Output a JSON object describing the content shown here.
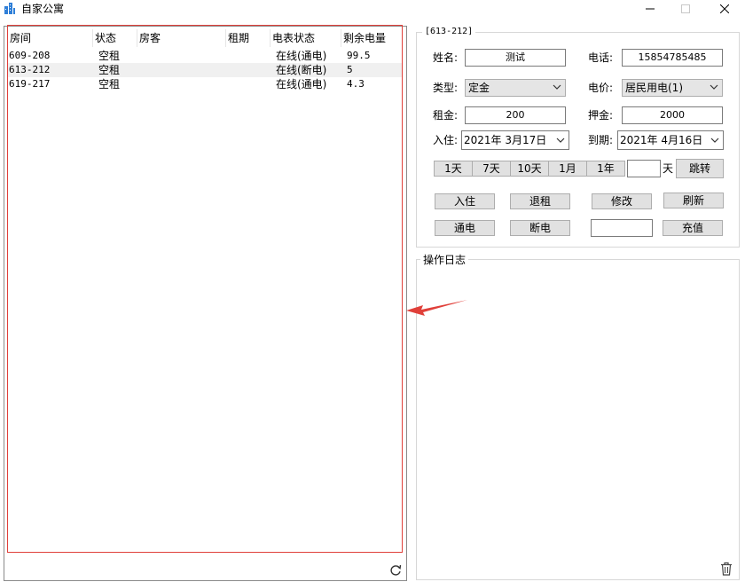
{
  "window": {
    "title": "自家公寓"
  },
  "list": {
    "columns": [
      "房间",
      "状态",
      "房客",
      "租期",
      "电表状态",
      "剩余电量"
    ],
    "rows": [
      [
        "609-208",
        "空租",
        "",
        "",
        "在线(通电)",
        "99.5"
      ],
      [
        "613-212",
        "空租",
        "",
        "",
        "在线(断电)",
        "5"
      ],
      [
        "619-217",
        "空租",
        "",
        "",
        "在线(通电)",
        "4.3"
      ]
    ],
    "selected_row": 1
  },
  "form": {
    "group_title": "[613-212]",
    "name_label": "姓名:",
    "name_value": "测试",
    "phone_label": "电话:",
    "phone_value": "15854785485",
    "type_label": "类型:",
    "type_value": "定金",
    "price_label": "电价:",
    "price_value": "居民用电(1)",
    "rent_label": "租金:",
    "rent_value": "200",
    "deposit_label": "押金:",
    "deposit_value": "2000",
    "checkin_label": "入住:",
    "checkin_date": "2021年  3月17日",
    "expire_label": "到期:",
    "expire_date": "2021年  4月16日",
    "periods": [
      "1天",
      "7天",
      "10天",
      "1月",
      "1年"
    ],
    "days_value": "",
    "days_unit": "天",
    "jump_button": "跳转",
    "checkin_button": "入住",
    "checkout_button": "退租",
    "modify_button": "修改",
    "refresh_button": "刷新",
    "power_on_button": "通电",
    "power_off_button": "断电",
    "recharge_value": "",
    "recharge_button": "充值"
  },
  "log": {
    "title": "操作日志"
  },
  "colors": {
    "annotation_red": "#e0403a",
    "app_icon_blue": "#2f7fd8"
  }
}
